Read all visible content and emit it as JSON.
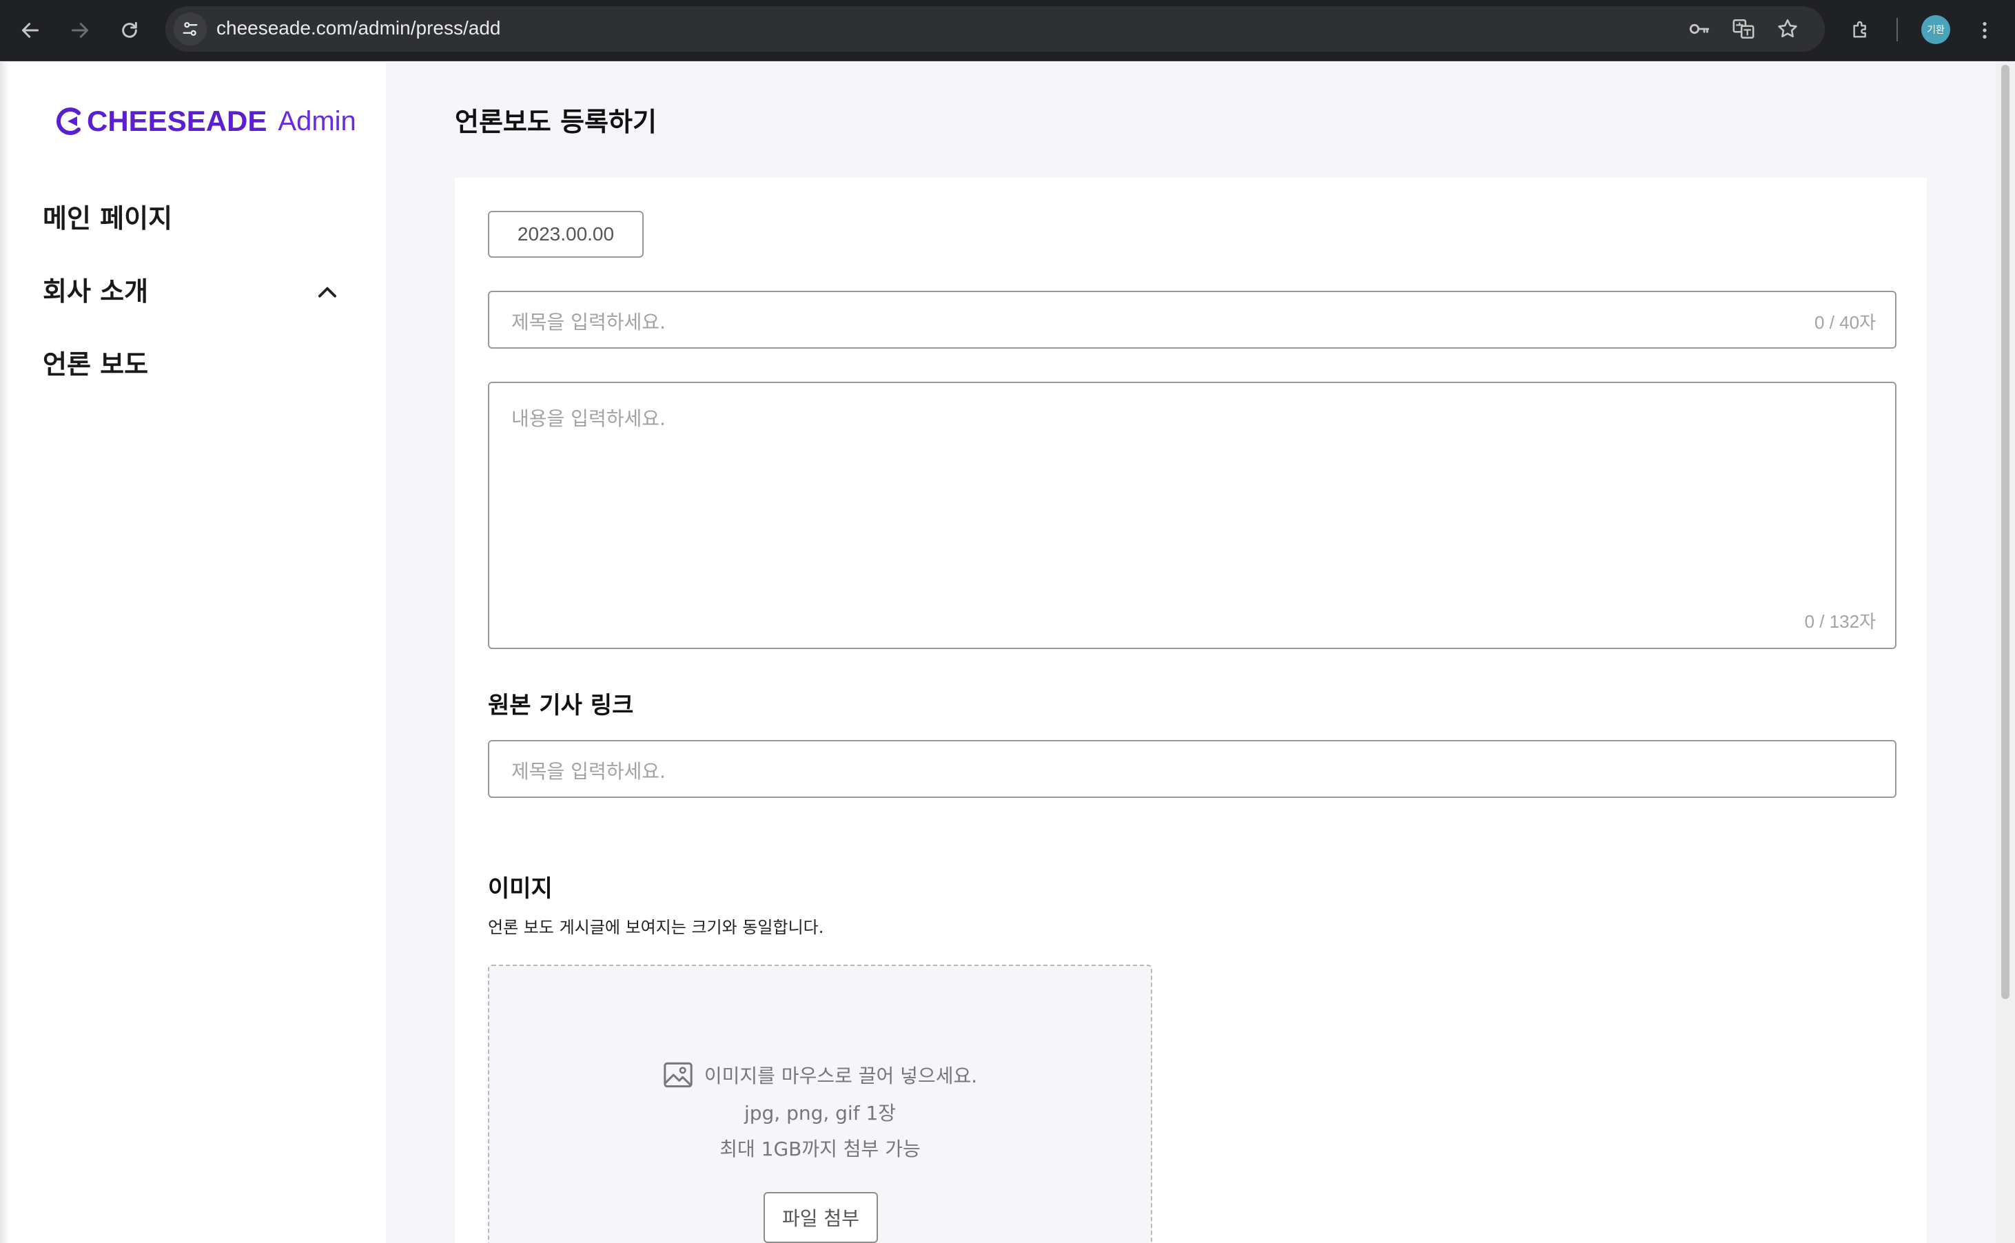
{
  "browser": {
    "url": "cheeseade.com/admin/press/add",
    "profile_initials": "기환",
    "icons": [
      "back-icon",
      "forward-icon",
      "reload-icon",
      "site-info-icon",
      "password-key-icon",
      "translate-icon",
      "bookmark-star-icon",
      "extensions-icon",
      "more-menu-icon"
    ]
  },
  "sidebar": {
    "logo_text": "CHEESEADE",
    "logo_suffix": "Admin",
    "items": [
      {
        "label": "메인 페이지"
      },
      {
        "label": "회사 소개",
        "expanded": true
      },
      {
        "label": "언론 보도"
      }
    ]
  },
  "main": {
    "title": "언론보도 등록하기",
    "date_value": "2023.00.00",
    "title_field": {
      "placeholder": "제목을 입력하세요.",
      "counter": "0 / 40자"
    },
    "content_field": {
      "placeholder": "내용을 입력하세요.",
      "counter": "0 / 132자"
    },
    "link_section": {
      "label": "원본 기사 링크",
      "placeholder": "제목을 입력하세요."
    },
    "image_section": {
      "label": "이미지",
      "description": "언론 보도 게시글에 보여지는 크기와 동일합니다.",
      "drop_text": "이미지를 마우스로 끌어 넣으세요.",
      "formats": "jpg, png, gif 1장",
      "limit": "최대 1GB까지 첨부 가능",
      "attach_button": "파일 첨부"
    }
  },
  "colors": {
    "brand": "#5b1fd1",
    "main_bg": "#f6f5f9",
    "chrome_bg": "#202124"
  }
}
